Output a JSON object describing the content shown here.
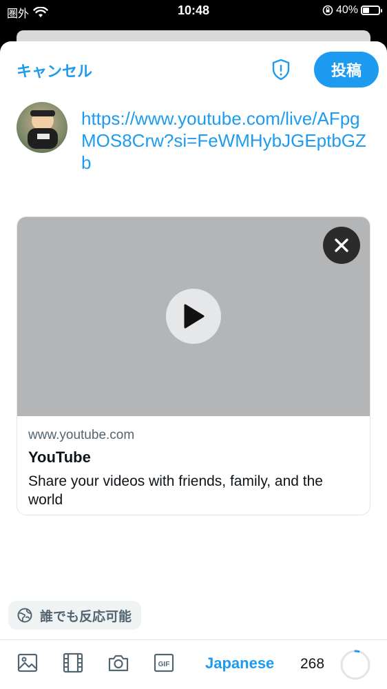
{
  "status_bar": {
    "carrier": "圏外",
    "time": "10:48",
    "battery_percent": "40%",
    "battery_level": 0.4
  },
  "header": {
    "cancel_label": "キャンセル",
    "post_label": "投稿"
  },
  "composer": {
    "text": "https://www.youtube.com/live/AFpgMOS8Crw?si=FeWMHybJGEptbGZb"
  },
  "link_card": {
    "domain": "www.youtube.com",
    "title": "YouTube",
    "description": "Share your videos with friends, family, and the world"
  },
  "reply_settings": {
    "label": "誰でも反応可能"
  },
  "toolbar": {
    "language_label": "Japanese",
    "char_remaining": "268",
    "char_progress": 0.04,
    "icons": [
      "image-icon",
      "video-icon",
      "camera-icon",
      "gif-icon"
    ]
  },
  "colors": {
    "accent": "#1d9bf0",
    "text": "#0f1419",
    "muted": "#536471",
    "media_bg": "#b4b5b7"
  }
}
